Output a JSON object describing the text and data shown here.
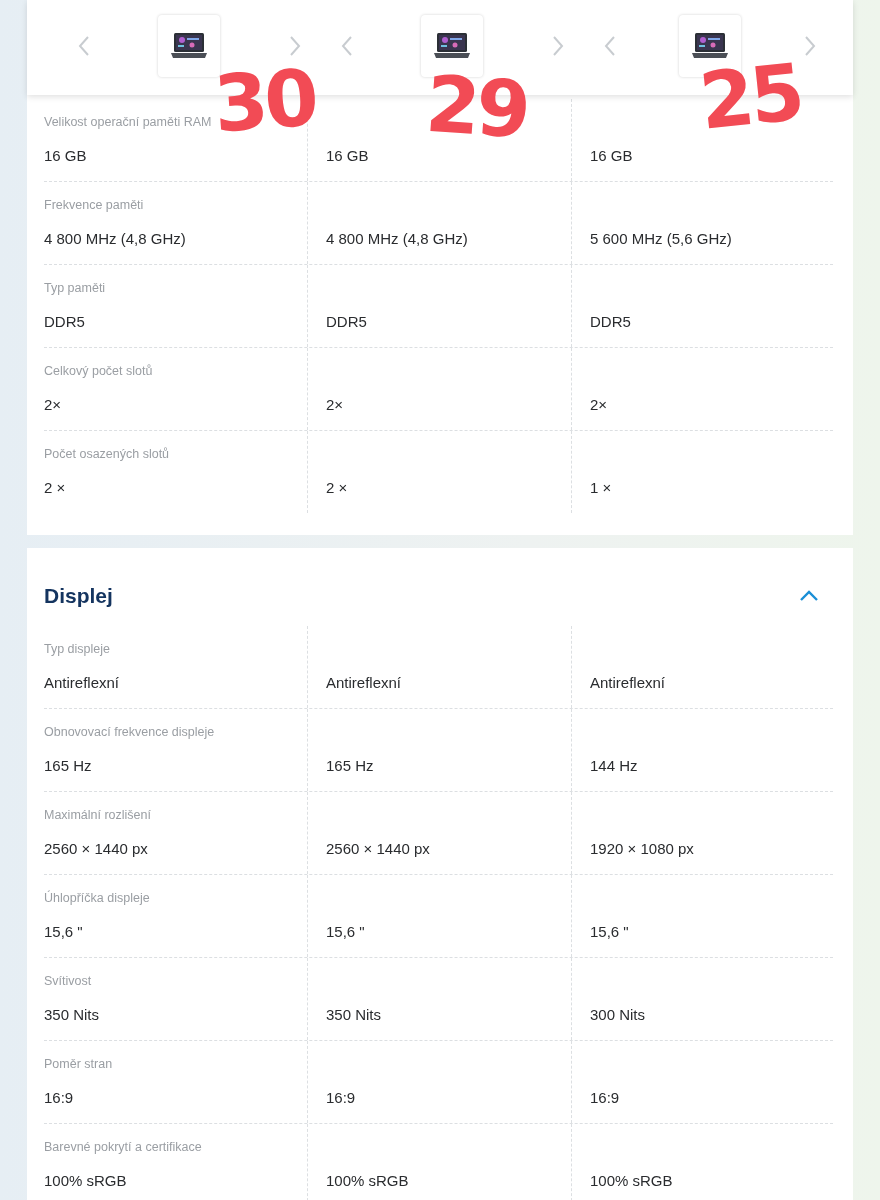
{
  "annotations": [
    "30",
    "29",
    "25"
  ],
  "sections": [
    {
      "rows": [
        {
          "label": "Velikost operační paměti RAM",
          "values": [
            "16 GB",
            "16 GB",
            "16 GB"
          ]
        },
        {
          "label": "Frekvence paměti",
          "values": [
            "4 800 MHz (4,8 GHz)",
            "4 800 MHz (4,8 GHz)",
            "5 600 MHz (5,6 GHz)"
          ]
        },
        {
          "label": "Typ paměti",
          "values": [
            "DDR5",
            "DDR5",
            "DDR5"
          ]
        },
        {
          "label": "Celkový počet slotů",
          "values": [
            "2×",
            "2×",
            "2×"
          ]
        },
        {
          "label": "Počet osazených slotů",
          "values": [
            "2 ×",
            "2 ×",
            "1 ×"
          ]
        }
      ]
    },
    {
      "title": "Displej",
      "expanded": true,
      "rows": [
        {
          "label": "Typ displeje",
          "values": [
            "Antireflexní",
            "Antireflexní",
            "Antireflexní"
          ]
        },
        {
          "label": "Obnovovací frekvence displeje",
          "values": [
            "165 Hz",
            "165 Hz",
            "144 Hz"
          ]
        },
        {
          "label": "Maximální rozlišení",
          "values": [
            "2560 × 1440 px",
            "2560 × 1440 px",
            "1920 × 1080 px"
          ]
        },
        {
          "label": "Úhlopříčka displeje",
          "values": [
            "15,6 \"",
            "15,6 \"",
            "15,6 \""
          ]
        },
        {
          "label": "Svítivost",
          "values": [
            "350 Nits",
            "350 Nits",
            "300 Nits"
          ]
        },
        {
          "label": "Poměr stran",
          "values": [
            "16:9",
            "16:9",
            "16:9"
          ]
        },
        {
          "label": "Barevné pokrytí a certifikace",
          "values": [
            "100% sRGB",
            "100% sRGB",
            "100% sRGB"
          ]
        }
      ]
    }
  ]
}
